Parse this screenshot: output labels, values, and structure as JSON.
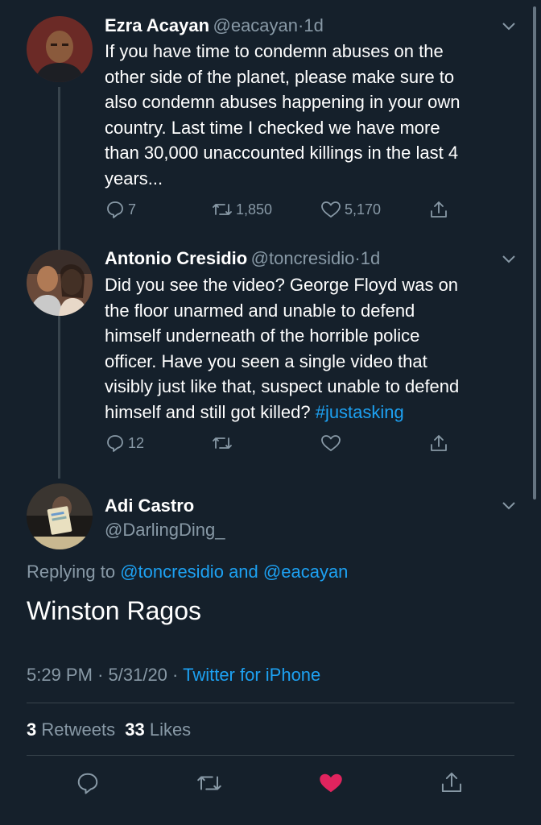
{
  "tweet1": {
    "name": "Ezra Acayan",
    "handle": "@eacayan",
    "sep": "·",
    "time": "1d",
    "lines": [
      "If you have time to condemn abuses on the",
      "other side of the planet, please make sure to",
      "also condemn abuses happening in your own",
      "country. Last time I checked we have more",
      "than 30,000 unaccounted killings in the last 4",
      "years..."
    ],
    "replies": "7",
    "retweets": "1,850",
    "likes": "5,170"
  },
  "tweet2": {
    "name": "Antonio Cresidio",
    "handle": "@toncresidio",
    "sep": "·",
    "time": "1d",
    "lines": [
      "Did you see the video? George Floyd was on",
      "the floor unarmed and unable to defend",
      "himself underneath of the horrible police",
      "officer. Have you seen a single video that",
      "visibly just like that, suspect unable to defend",
      "himself and still got killed?"
    ],
    "hashtag": "#justasking",
    "replies": "12"
  },
  "main": {
    "name": "Adi Castro",
    "handle": "@DarlingDing_",
    "replying_prefix": "Replying to",
    "replying_user1": "@toncresidio",
    "replying_and": "and",
    "replying_user2": "@eacayan",
    "text": "Winston Ragos",
    "time": "5:29 PM",
    "dot1": "·",
    "date": "5/31/20",
    "dot2": "·",
    "source": "Twitter for iPhone",
    "retweet_count": "3",
    "retweet_label": "Retweets",
    "like_count": "33",
    "like_label": "Likes"
  },
  "colors": {
    "background": "#15202b",
    "secondary_text": "#8899a6",
    "link": "#1da1f2",
    "like_active": "#e0245e",
    "divider": "#38444d"
  }
}
